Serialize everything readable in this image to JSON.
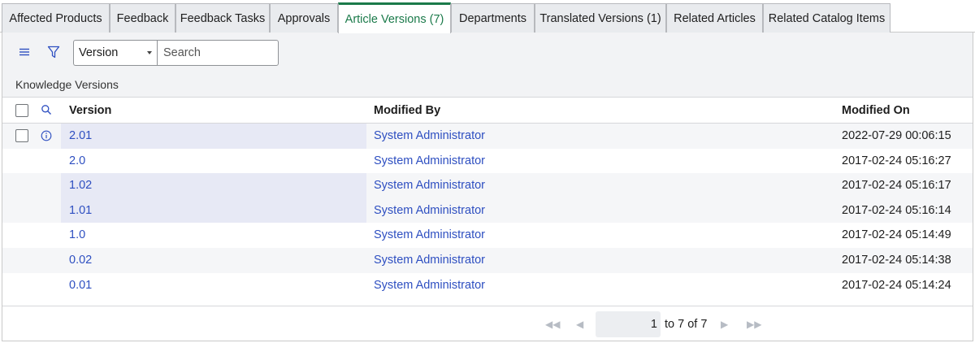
{
  "tabs": [
    {
      "label": "Affected Products"
    },
    {
      "label": "Feedback"
    },
    {
      "label": "Feedback Tasks"
    },
    {
      "label": "Approvals"
    },
    {
      "label": "Article Versions (7)"
    },
    {
      "label": "Departments"
    },
    {
      "label": "Translated Versions (1)"
    },
    {
      "label": "Related Articles"
    },
    {
      "label": "Related Catalog Items"
    }
  ],
  "active_tab": "Article Versions (7)",
  "toolbar": {
    "field_select": "Version",
    "search_placeholder": "Search"
  },
  "section_title": "Knowledge Versions",
  "table": {
    "columns": [
      "Version",
      "Modified By",
      "Modified On"
    ],
    "rows": [
      {
        "version": "2.01",
        "modified_by": "System Administrator",
        "modified_on": "2022-07-29 00:06:15"
      },
      {
        "version": "2.0",
        "modified_by": "System Administrator",
        "modified_on": "2017-02-24 05:16:27"
      },
      {
        "version": "1.02",
        "modified_by": "System Administrator",
        "modified_on": "2017-02-24 05:16:17"
      },
      {
        "version": "1.01",
        "modified_by": "System Administrator",
        "modified_on": "2017-02-24 05:16:14"
      },
      {
        "version": "1.0",
        "modified_by": "System Administrator",
        "modified_on": "2017-02-24 05:14:49"
      },
      {
        "version": "0.02",
        "modified_by": "System Administrator",
        "modified_on": "2017-02-24 05:14:38"
      },
      {
        "version": "0.01",
        "modified_by": "System Administrator",
        "modified_on": "2017-02-24 05:14:24"
      }
    ]
  },
  "pager": {
    "current_page_value": "1",
    "range_text": "to 7 of 7"
  },
  "colors": {
    "accent": "#1b7a4a",
    "link": "#2e4fc1",
    "tab_bg": "#e9ebee",
    "toolbar_bg": "#f2f3f5"
  }
}
